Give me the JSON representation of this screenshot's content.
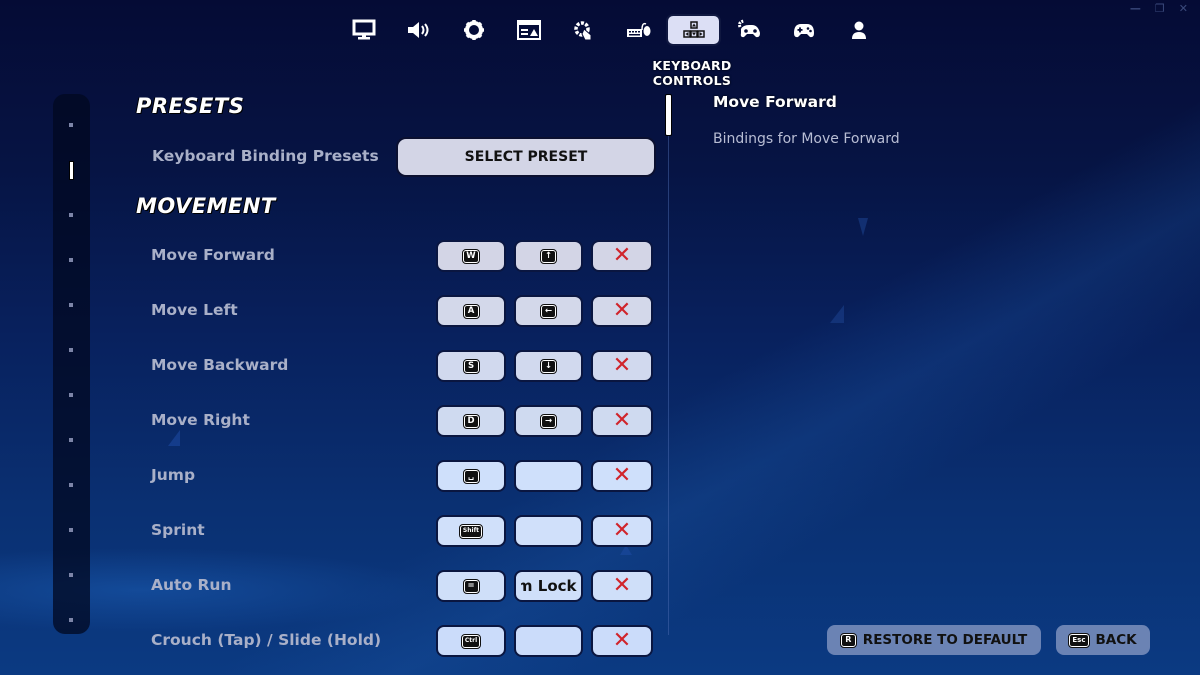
{
  "window_controls": [
    "minimize",
    "restore",
    "close"
  ],
  "tabs": [
    {
      "id": "display",
      "icon": "monitor-icon",
      "active": false
    },
    {
      "id": "audio",
      "icon": "speaker-icon",
      "active": false
    },
    {
      "id": "game",
      "icon": "gear-icon",
      "active": false
    },
    {
      "id": "accessibility",
      "icon": "ui-window-icon",
      "active": false
    },
    {
      "id": "touch",
      "icon": "touch-gear-icon",
      "active": false
    },
    {
      "id": "mouse-keyboard",
      "icon": "keyboard-mouse-icon",
      "active": false
    },
    {
      "id": "keyboard-controls",
      "icon": "arrow-keys-icon",
      "active": true
    },
    {
      "id": "controller-settings",
      "icon": "controller-gear-icon",
      "active": false
    },
    {
      "id": "controller",
      "icon": "gamepad-icon",
      "active": false
    },
    {
      "id": "account",
      "icon": "user-icon",
      "active": false
    }
  ],
  "active_tab_caption": "KEYBOARD CONTROLS",
  "rail": {
    "marker_count": 12,
    "active_index": 1
  },
  "sections": {
    "presets": {
      "title": "PRESETS",
      "label": "Keyboard Binding Presets",
      "button": "SELECT PRESET"
    },
    "movement": {
      "title": "MOVEMENT",
      "rows": [
        {
          "label": "Move Forward",
          "primary": "W",
          "secondary": "↑",
          "secondary_type": "key"
        },
        {
          "label": "Move Left",
          "primary": "A",
          "secondary": "←",
          "secondary_type": "key"
        },
        {
          "label": "Move Backward",
          "primary": "S",
          "secondary": "↓",
          "secondary_type": "key"
        },
        {
          "label": "Move Right",
          "primary": "D",
          "secondary": "→",
          "secondary_type": "key"
        },
        {
          "label": "Jump",
          "primary": "␣",
          "secondary": "",
          "secondary_type": "empty"
        },
        {
          "label": "Sprint",
          "primary": "Shift",
          "secondary": "",
          "secondary_type": "empty"
        },
        {
          "label": "Auto Run",
          "primary": "=",
          "secondary": "Num Lock",
          "secondary_type": "text"
        },
        {
          "label": "Crouch (Tap) / Slide (Hold)",
          "primary": "Ctrl",
          "secondary": "",
          "secondary_type": "empty"
        }
      ],
      "clear_symbol": "✕"
    }
  },
  "detail": {
    "title": "Move Forward",
    "description": "Bindings for Move Forward"
  },
  "footer": {
    "restore": {
      "key": "R",
      "label": "RESTORE TO DEFAULT"
    },
    "back": {
      "key": "Esc",
      "label": "BACK"
    }
  },
  "colors": {
    "bg_top": "#050b35",
    "bg_bottom": "#0b3a82",
    "button_light": "#d3d5e6",
    "clear_red": "#d0242b",
    "footer_button": "#6b83b4",
    "label_gray": "#a9b0c8"
  }
}
